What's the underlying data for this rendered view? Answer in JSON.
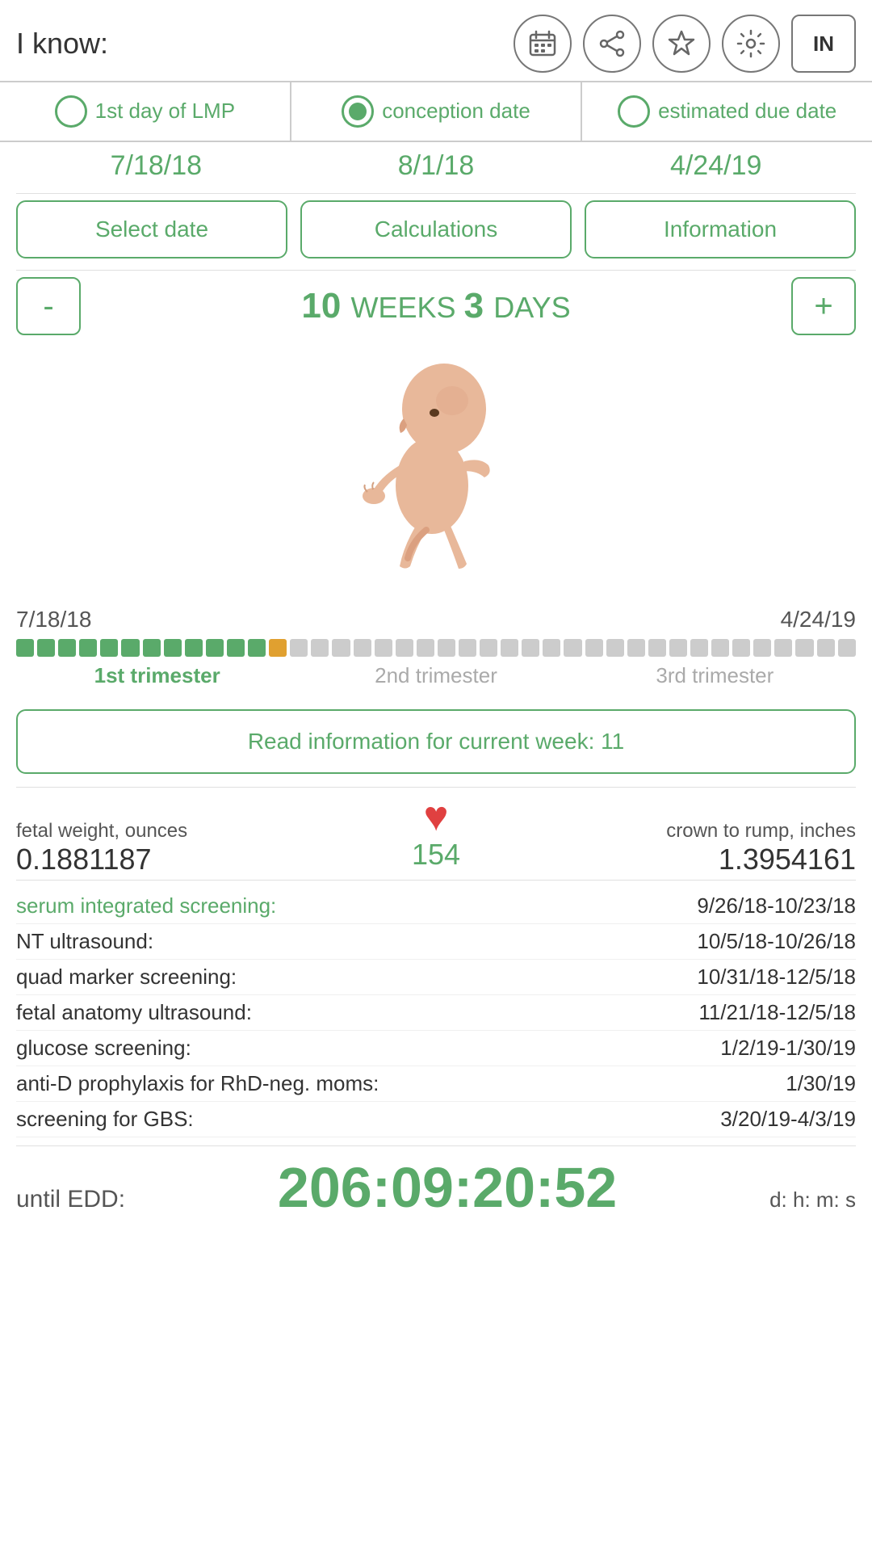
{
  "header": {
    "i_know_label": "I know:",
    "icons": [
      {
        "name": "calendar-icon",
        "symbol": "📅"
      },
      {
        "name": "share-icon",
        "symbol": "🔗"
      },
      {
        "name": "star-icon",
        "symbol": "☆"
      },
      {
        "name": "settings-icon",
        "symbol": "⚙"
      },
      {
        "name": "units-btn",
        "label": "IN"
      }
    ]
  },
  "radio_options": [
    {
      "id": "lmp",
      "label": "1st day of LMP",
      "checked": false
    },
    {
      "id": "conception",
      "label": "conception date",
      "checked": true
    },
    {
      "id": "due",
      "label": "estimated due date",
      "checked": false
    }
  ],
  "dates": {
    "lmp": "7/18/18",
    "conception": "8/1/18",
    "due": "4/24/19"
  },
  "buttons": {
    "select_date": "Select date",
    "calculations": "Calculations",
    "information": "Information"
  },
  "weeks": {
    "minus": "-",
    "plus": "+",
    "weeks_num": "10",
    "weeks_label": "WEEKS",
    "days_num": "3",
    "days_label": "DAYS"
  },
  "progress": {
    "start_date": "7/18/18",
    "end_date": "4/24/19",
    "green_segments": 12,
    "orange_segments": 1,
    "gray_segments": 27,
    "trimester_labels": [
      "1st trimester",
      "2nd trimester",
      "3rd trimester"
    ]
  },
  "read_info_btn": "Read information for current week: 11",
  "stats": {
    "fetal_weight_label": "fetal weight, ounces",
    "fetal_weight_value": "0.1881187",
    "heart_rate": "154",
    "crown_rump_label": "crown to rump, inches",
    "crown_rump_value": "1.3954161"
  },
  "screening": [
    {
      "label": "serum integrated screening:",
      "label_green": true,
      "date": "9/26/18-10/23/18"
    },
    {
      "label": "NT ultrasound:",
      "label_green": false,
      "date": "10/5/18-10/26/18"
    },
    {
      "label": "quad marker screening:",
      "label_green": false,
      "date": "10/31/18-12/5/18"
    },
    {
      "label": "fetal anatomy ultrasound:",
      "label_green": false,
      "date": "11/21/18-12/5/18"
    },
    {
      "label": "glucose screening:",
      "label_green": false,
      "date": "1/2/19-1/30/19"
    },
    {
      "label": "anti-D prophylaxis for RhD-neg. moms:",
      "label_green": false,
      "date": "1/30/19"
    },
    {
      "label": "screening for GBS:",
      "label_green": false,
      "date": "3/20/19-4/3/19"
    }
  ],
  "countdown": {
    "label": "until EDD:",
    "value": "206:09:20:52",
    "units": "d: h: m: s"
  }
}
